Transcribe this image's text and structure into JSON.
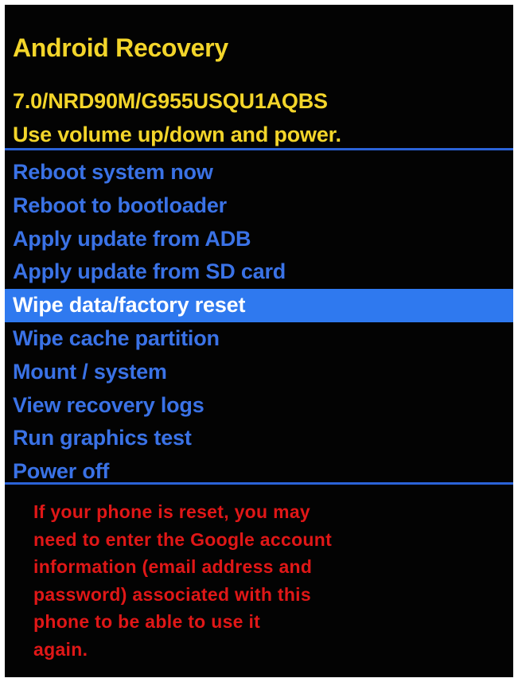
{
  "header": {
    "title": "Android Recovery",
    "build": "7.0/NRD90M/G955USQU1AQBS",
    "instructions": "Use volume up/down and power."
  },
  "menu": {
    "selected_index": 4,
    "items": [
      {
        "label": "Reboot system now"
      },
      {
        "label": "Reboot to bootloader"
      },
      {
        "label": "Apply update from ADB"
      },
      {
        "label": "Apply update from SD card"
      },
      {
        "label": "Wipe data/factory reset"
      },
      {
        "label": "Wipe cache partition"
      },
      {
        "label": "Mount / system"
      },
      {
        "label": "View recovery logs"
      },
      {
        "label": "Run graphics test"
      },
      {
        "label": "Power off"
      }
    ]
  },
  "warning": {
    "text": "If your phone is reset, you may\nneed to enter the Google account\ninformation (email address and\npassword) associated with this\nphone to be able to use it\nagain."
  },
  "colors": {
    "background": "#030303",
    "header_text": "#f3d52a",
    "menu_text": "#3a72e6",
    "selection_bg": "#2f79ef",
    "selection_text": "#ffffff",
    "divider": "#2b63d8",
    "warning_text": "#e01717"
  }
}
